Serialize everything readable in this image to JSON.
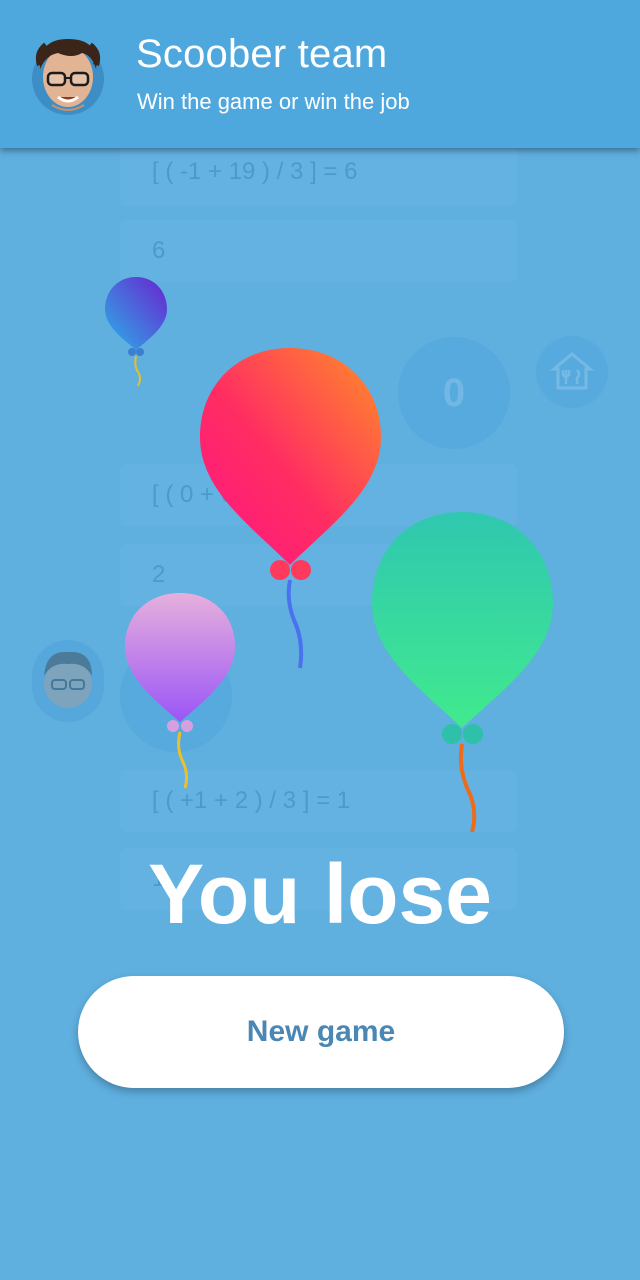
{
  "header": {
    "title": "Scoober team",
    "subtitle": "Win the game or win the job"
  },
  "board": {
    "cards": [
      "[ ( -1 + 19 )  / 3 ] = 6",
      "6",
      "[ ( 0 + 6",
      "2",
      "[ ( +1 + 2 )  / 3 ] = 1",
      "1"
    ],
    "score": "0"
  },
  "result": {
    "message": "You lose",
    "button_label": "New game"
  },
  "colors": {
    "background": "#5fafdf",
    "header": "#4ea8de",
    "button_text": "#4a87b5"
  }
}
